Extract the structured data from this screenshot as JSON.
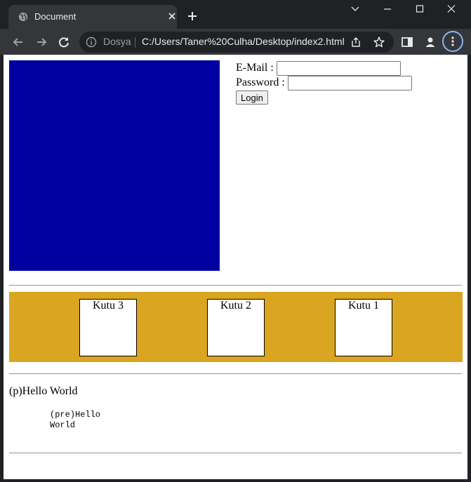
{
  "browser": {
    "tab_title": "Document",
    "scheme_label": "Dosya",
    "url": "C:/Users/Taner%20Culha/Desktop/index2.html"
  },
  "page": {
    "login": {
      "email_label": "E-Mail :",
      "email_value": "",
      "password_label": "Password :",
      "password_value": "",
      "button_label": "Login"
    },
    "boxes": [
      "Kutu 3",
      "Kutu 2",
      "Kutu 1"
    ],
    "paragraph": "(p)Hello World",
    "pre_text": "(pre)Hello\nWorld"
  },
  "colors": {
    "blue_box": "#0000a0",
    "band": "#daa520",
    "chrome_dark": "#202124",
    "chrome_toolbar": "#35363a",
    "accent": "#8ab4f8"
  }
}
